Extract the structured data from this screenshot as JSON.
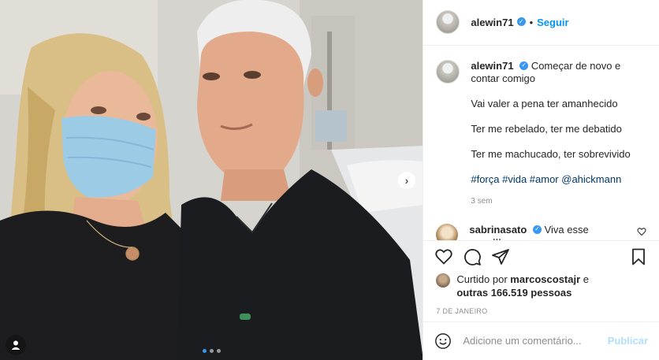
{
  "post": {
    "username": "alewin71",
    "follow_label": "Seguir",
    "separator": "•",
    "caption": {
      "first_line": "Começar de novo e contar comigo",
      "lines": [
        "Vai valer a pena ter amanhecido",
        "Ter me rebelado, ter me debatido",
        "Ter me machucado, ter sobrevivido"
      ],
      "hashtags": "#força #vida #amor @ahickmann"
    },
    "time_ago": "3 sem",
    "comment": {
      "username": "sabrinasato",
      "text": "Viva esse amor!!!"
    },
    "likes": {
      "prefix": "Curtido por ",
      "liker": "marcoscostajr",
      "middle": " e",
      "others": "outras 166.519 pessoas"
    },
    "date": "7 DE JANEIRO",
    "add_comment_placeholder": "Adicione um comentário...",
    "publish_label": "Publicar",
    "carousel": {
      "total": 3,
      "active_index": 1
    }
  },
  "icons": {
    "heart": "heart-icon",
    "comment": "comment-icon",
    "share": "share-icon",
    "save": "bookmark-icon",
    "emoji": "emoji-icon",
    "user_tag": "user-tag-icon",
    "next": "chevron-right-icon",
    "verified": "verified-badge-icon"
  },
  "colors": {
    "accent": "#0095f6",
    "verified": "#3897f0",
    "publish_disabled": "#b2dffc",
    "muted": "#8e8e8e",
    "hashtag": "#00376b"
  }
}
